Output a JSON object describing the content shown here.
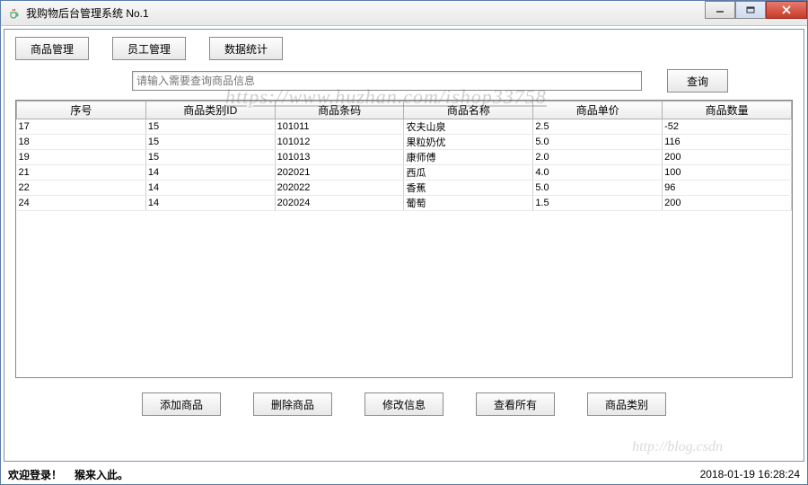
{
  "window": {
    "title": "我购物后台管理系统 No.1"
  },
  "tabs": {
    "product": "商品管理",
    "employee": "员工管理",
    "stats": "数据统计"
  },
  "search": {
    "placeholder": "请输入需要查询商品信息",
    "value": "",
    "button": "查询"
  },
  "table": {
    "headers": [
      "序号",
      "商品类别ID",
      "商品条码",
      "商品名称",
      "商品单价",
      "商品数量"
    ],
    "rows": [
      [
        "17",
        "15",
        "101011",
        "农夫山泉",
        "2.5",
        "-52"
      ],
      [
        "18",
        "15",
        "101012",
        "果粒奶优",
        "5.0",
        "116"
      ],
      [
        "19",
        "15",
        "101013",
        "康师傅",
        "2.0",
        "200"
      ],
      [
        "21",
        "14",
        "202021",
        "西瓜",
        "4.0",
        "100"
      ],
      [
        "22",
        "14",
        "202022",
        "香蕉",
        "5.0",
        "96"
      ],
      [
        "24",
        "14",
        "202024",
        "葡萄",
        "1.5",
        "200"
      ]
    ]
  },
  "actions": {
    "add": "添加商品",
    "delete": "删除商品",
    "modify": "修改信息",
    "viewAll": "查看所有",
    "category": "商品类别"
  },
  "status": {
    "welcome": "欢迎登录！",
    "here": "猴来入此。",
    "timestamp": "2018-01-19 16:28:24"
  },
  "watermark": {
    "url": "https://www.huzhan.com/ishop33758",
    "blog": "http://blog.csdn"
  }
}
